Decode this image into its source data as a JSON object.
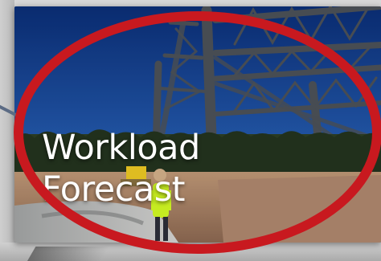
{
  "tile": {
    "title_line_1": "Workload",
    "title_line_2": "Forecast",
    "scene_icon": "construction-site-photo-icon"
  },
  "annotation": {
    "shape": "ellipse",
    "color": "#c8191f"
  },
  "colors": {
    "sky_top": "#0b2f79",
    "sky_bottom": "#4b82c6",
    "steel": "#4e5359",
    "ground": "#b69172",
    "trees": "#2d3f25",
    "safety_vest": "#d6ff24"
  }
}
